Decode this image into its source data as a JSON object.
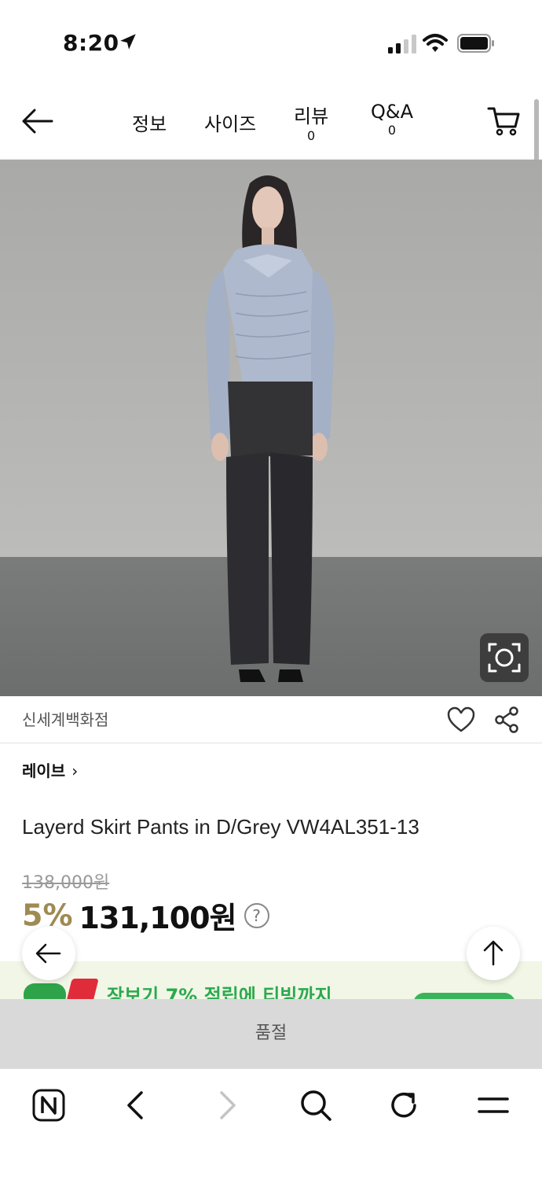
{
  "status_bar": {
    "time": "8:20"
  },
  "header": {
    "tabs": [
      {
        "label": "정보"
      },
      {
        "label": "사이즈"
      },
      {
        "label": "리뷰",
        "count": "0"
      },
      {
        "label": "Q&A",
        "count": "0"
      }
    ]
  },
  "product": {
    "seller": "신세계백화점",
    "brand": "레이브",
    "brand_chevron": "›",
    "title": "Layerd Skirt Pants in D/Grey VW4AL351-13",
    "original_price": "138,000원",
    "discount": "5%",
    "price": "131,100원",
    "price_help": "?"
  },
  "promo": {
    "text": "장보기 7% 적립에 티빙까지"
  },
  "soldout_label": "품절",
  "colors": {
    "accent_gold": "#9e8a53",
    "promo_green": "#2ca94e",
    "soldout_bg": "#d9d9d9"
  }
}
